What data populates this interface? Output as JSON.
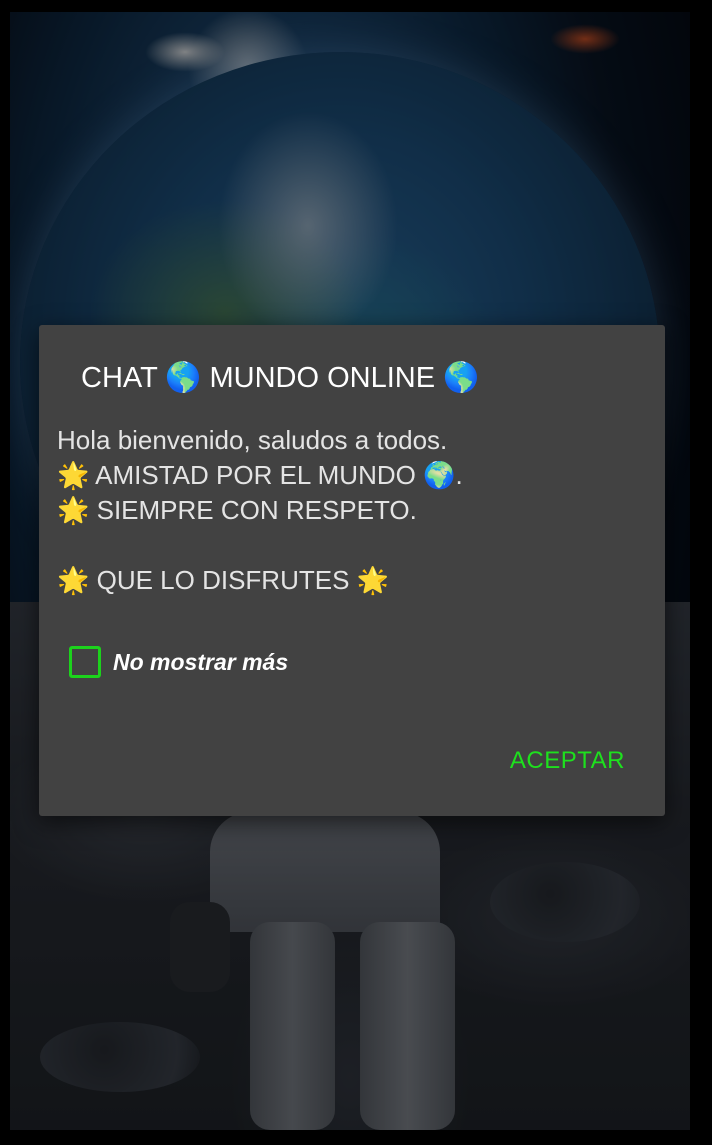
{
  "dialog": {
    "title": "CHAT 🌎 MUNDO ONLINE 🌎",
    "message_lines": [
      "Hola bienvenido, saludos a todos.",
      "🌟 AMISTAD POR EL MUNDO 🌍.",
      "🌟 SIEMPRE CON RESPETO.",
      "",
      "🌟 QUE LO DISFRUTES 🌟"
    ],
    "checkbox_label": "No mostrar más",
    "checkbox_checked": false,
    "accept_label": "ACEPTAR"
  },
  "colors": {
    "dialog_background": "#424242",
    "accent_green": "#1ee01e",
    "title_text": "#ffffff",
    "message_text": "#e4e4e4"
  },
  "icons": [
    "globe-americas-icon",
    "star-icon",
    "globe-europe-africa-icon"
  ]
}
